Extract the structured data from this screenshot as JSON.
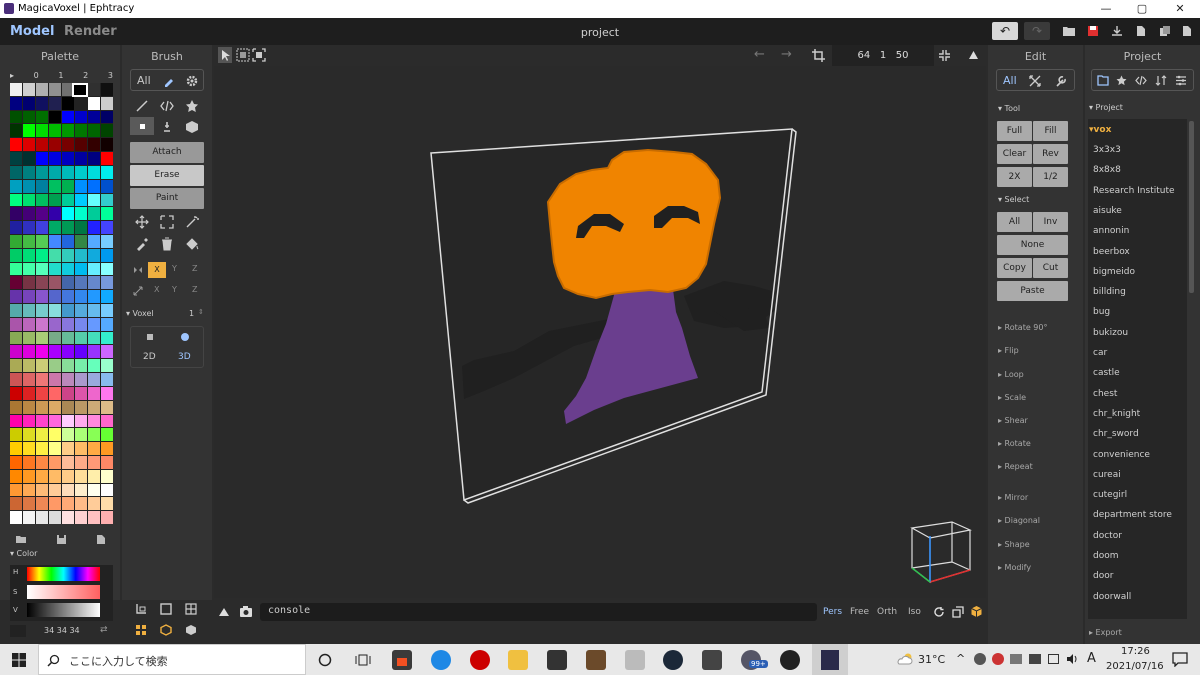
{
  "window": {
    "title": "MagicaVoxel | Ephtracy",
    "controls": [
      "—",
      "▢",
      "✕"
    ]
  },
  "modes": {
    "model": "Model",
    "render": "Render"
  },
  "project_title": "project",
  "history": {
    "undo": "↶",
    "redo": "↷"
  },
  "dims": {
    "x": "64",
    "y": "1",
    "z": "50"
  },
  "palette": {
    "title": "Palette",
    "pages": [
      "▸",
      "0",
      "1",
      "2",
      "3"
    ],
    "footer_icons": [
      "folder-icon",
      "save-icon",
      "file-icon"
    ],
    "colors": [
      "#f0f0f0",
      "#d0d0d0",
      "#b0b0b0",
      "#909090",
      "#707070",
      "#505050",
      "#303030",
      "#101010",
      "#000080",
      "#000070",
      "#101060",
      "#202050",
      "#000000",
      "#222222",
      "#ffffff",
      "#cccccc",
      "#005000",
      "#006000",
      "#007000",
      "#000000",
      "#0000ff",
      "#0000cc",
      "#000099",
      "#000066",
      "#003300",
      "#00ff00",
      "#00dd00",
      "#00bb00",
      "#009900",
      "#007700",
      "#006600",
      "#004400",
      "#ff0000",
      "#dd0000",
      "#bb0000",
      "#990000",
      "#770000",
      "#550000",
      "#330000",
      "#110000",
      "#004040",
      "#003030",
      "#0000ff",
      "#0000e0",
      "#0000c0",
      "#0000a0",
      "#000080",
      "#ff0000",
      "#006666",
      "#008080",
      "#009999",
      "#00aaaa",
      "#00bbbb",
      "#00cccc",
      "#00dddd",
      "#00eeee",
      "#00a0c0",
      "#0090b0",
      "#0080a0",
      "#00c060",
      "#00b050",
      "#0090ff",
      "#0070ff",
      "#0050cc",
      "#00ff80",
      "#00e070",
      "#00c060",
      "#00a050",
      "#00cc99",
      "#00ccff",
      "#66ffff",
      "#33cccc",
      "#330066",
      "#440077",
      "#550088",
      "#3300aa",
      "#00ffff",
      "#00ffcc",
      "#00cc99",
      "#00ff99",
      "#2020a0",
      "#3030c0",
      "#4040e0",
      "#00aa66",
      "#009955",
      "#007744",
      "#2222ff",
      "#4444ff",
      "#33aa33",
      "#44bb44",
      "#55cc55",
      "#4488ff",
      "#2266dd",
      "#338844",
      "#55aaff",
      "#77ccff",
      "#00cc66",
      "#00dd77",
      "#00ee88",
      "#44ddaa",
      "#33ccbb",
      "#22bbcc",
      "#11aadd",
      "#0099ee",
      "#33ff99",
      "#44ffaa",
      "#55ffbb",
      "#22ddcc",
      "#11ccdd",
      "#00bbee",
      "#66eeff",
      "#88ffff",
      "#660033",
      "#773344",
      "#884455",
      "#995566",
      "#4466aa",
      "#5577bb",
      "#6688cc",
      "#7799dd",
      "#6633aa",
      "#7744bb",
      "#8855cc",
      "#5566cc",
      "#4477dd",
      "#3388ee",
      "#2299ff",
      "#11aaff",
      "#55aaaa",
      "#66bbbb",
      "#77cccc",
      "#88dddd",
      "#4499cc",
      "#55aadd",
      "#66bbee",
      "#77ccff",
      "#aa55aa",
      "#bb66bb",
      "#cc77cc",
      "#9966cc",
      "#8877dd",
      "#7788ee",
      "#6699ff",
      "#55aaff",
      "#88aa55",
      "#99bb66",
      "#aacc77",
      "#77aa88",
      "#66bb99",
      "#55ccaa",
      "#44ddbb",
      "#33eecc",
      "#cc00cc",
      "#dd00dd",
      "#ee00ee",
      "#aa00ff",
      "#8800ff",
      "#6600ff",
      "#9933ff",
      "#cc66ff",
      "#aaaa55",
      "#bbbb66",
      "#cccc77",
      "#99cc88",
      "#88dd99",
      "#77eeaa",
      "#66ffbb",
      "#99ffcc",
      "#cc5555",
      "#dd6666",
      "#ee7777",
      "#cc77aa",
      "#bb88bb",
      "#aa99cc",
      "#99aadd",
      "#88bbee",
      "#cc0000",
      "#dd2222",
      "#ee4444",
      "#ff6666",
      "#cc4488",
      "#dd55aa",
      "#ee66cc",
      "#ff77ee",
      "#aa7733",
      "#bb8844",
      "#cc9955",
      "#ddaa66",
      "#aa8855",
      "#bb9966",
      "#ccaa77",
      "#ddbb88",
      "#ff00aa",
      "#ff22bb",
      "#ff44cc",
      "#ff66dd",
      "#ffccff",
      "#ffaaee",
      "#ff88dd",
      "#ff66cc",
      "#cccc00",
      "#dddd22",
      "#eeee44",
      "#ffff66",
      "#ccff99",
      "#aaff77",
      "#88ff55",
      "#66ff33",
      "#ffcc00",
      "#ffdd22",
      "#ffee44",
      "#ffff88",
      "#ffcc88",
      "#ffbb66",
      "#ffaa44",
      "#ff9922",
      "#ff6600",
      "#ff7722",
      "#ff8844",
      "#ff9966",
      "#ffbb99",
      "#ffaa88",
      "#ff9977",
      "#ff8866",
      "#ff8800",
      "#ff9922",
      "#ffaa44",
      "#ffbb66",
      "#ffcc88",
      "#ffdd99",
      "#ffeeaa",
      "#ffffcc",
      "#ff9933",
      "#ffaa55",
      "#ffbb77",
      "#ffcc99",
      "#ffddbb",
      "#ffeecc",
      "#ffffee",
      "#ffffff",
      "#cc6633",
      "#dd7744",
      "#ee8855",
      "#ff9966",
      "#ffaa77",
      "#ffbb88",
      "#ffcc99",
      "#ffddaa",
      "#ffffff",
      "#f4f4f4",
      "#e8e8e8",
      "#dcdcdc",
      "#ffe0e0",
      "#ffd0d0",
      "#ffc0c0",
      "#ffb0b0"
    ]
  },
  "color_panel": {
    "title": "▾ Color",
    "h": "H",
    "s": "S",
    "v": "V",
    "rgb": "34  34  34",
    "swap": "⇄"
  },
  "brush": {
    "title": "Brush",
    "all": "All",
    "attach": "Attach",
    "erase": "Erase",
    "paint": "Paint",
    "axes1": [
      "X",
      "Y",
      "Z"
    ],
    "axes2": [
      "X",
      "Y",
      "Z"
    ],
    "voxel_label": "▾ Voxel",
    "voxel_value": "1",
    "dim2": "2D",
    "dim3": "3D"
  },
  "edit": {
    "title": "Edit",
    "all": "All",
    "tool_head": "▾ Tool",
    "tool_buttons": [
      "Full",
      "Fill",
      "Clear",
      "Rev",
      "2X",
      "1/2"
    ],
    "select_head": "▾ Select",
    "select_buttons": [
      "All",
      "Inv"
    ],
    "none": "None",
    "copy": "Copy",
    "cut": "Cut",
    "paste": "Paste",
    "group1": [
      "▸ Rotate 90°",
      "▸ Flip",
      "▸ Loop",
      "▸ Scale",
      "▸ Shear",
      "▸ Rotate",
      "▸ Repeat"
    ],
    "group2": [
      "▸ Mirror",
      "▸ Diagonal",
      "▸ Shape",
      "▸ Modify"
    ]
  },
  "project_panel": {
    "title": "Project",
    "head": "▾ Project",
    "folder": "▾vox",
    "items": [
      "3x3x3",
      "8x8x8",
      "Research Institute",
      "aisuke",
      "annonin",
      "beerbox",
      "bigmeido",
      "billding",
      "bug",
      "bukizou",
      "car",
      "castle",
      "chest",
      "chr_knight",
      "chr_sword",
      "convenience",
      "cureai",
      "cutegirl",
      "department store",
      "doctor",
      "doom",
      "door",
      "doorwall"
    ],
    "export": "▸ Export"
  },
  "console": {
    "label": "console",
    "views": [
      "Pers",
      "Free",
      "Orth",
      "Iso"
    ]
  },
  "taskbar": {
    "search_placeholder": "ここに入力して検索",
    "weather": "31°C",
    "ime": "A",
    "time": "17:26",
    "date": "2021/07/16",
    "badge": "99+"
  },
  "colors": {
    "orange": "#f08400",
    "orange_dark": "#c86c00",
    "purple": "#6a3e8e",
    "dark_voxel": "#202020",
    "accent": "#9fc6ff",
    "selected_axis": "#f0b040"
  }
}
